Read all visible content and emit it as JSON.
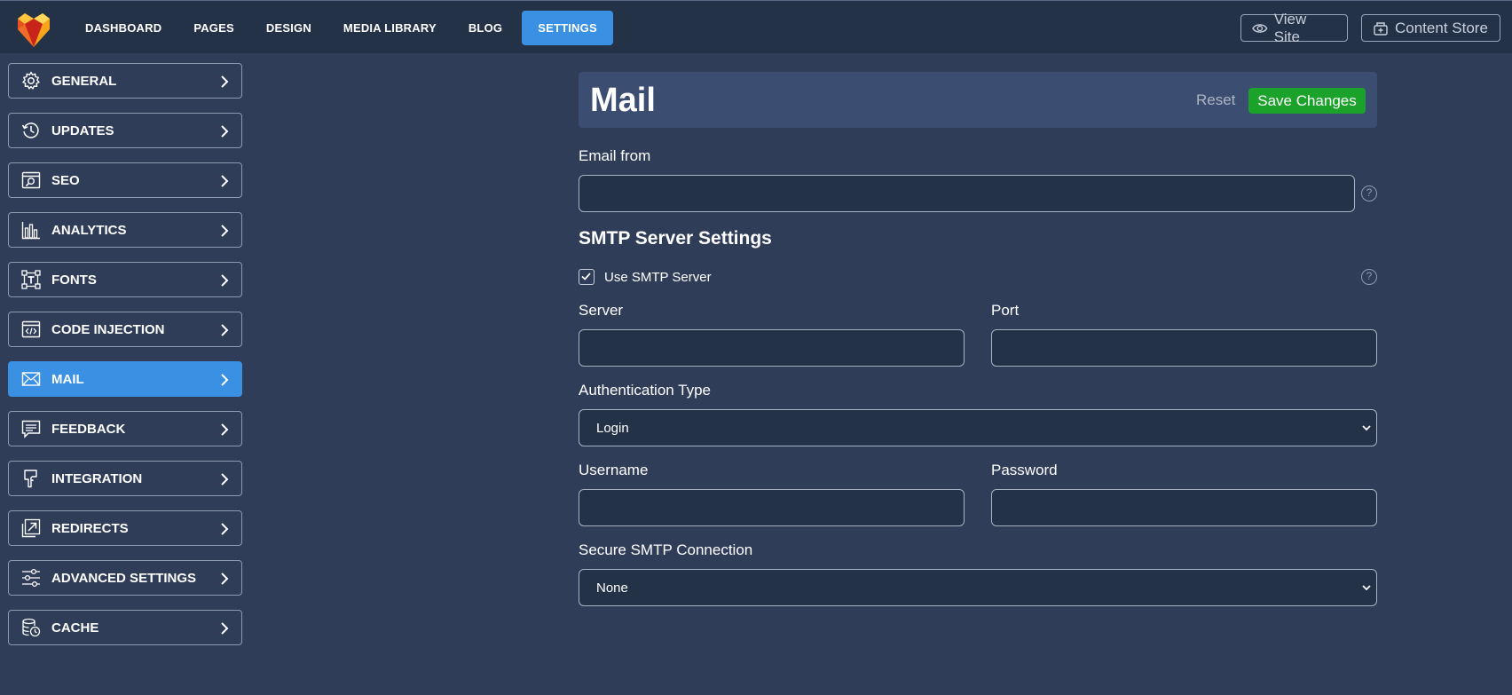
{
  "nav": {
    "items": [
      {
        "label": "DASHBOARD"
      },
      {
        "label": "PAGES"
      },
      {
        "label": "DESIGN"
      },
      {
        "label": "MEDIA LIBRARY"
      },
      {
        "label": "BLOG"
      },
      {
        "label": "SETTINGS",
        "active": true
      }
    ],
    "view_site": "View Site",
    "content_store": "Content Store"
  },
  "sidebar": {
    "items": [
      {
        "label": "GENERAL",
        "icon": "gear-icon"
      },
      {
        "label": "UPDATES",
        "icon": "history-icon"
      },
      {
        "label": "SEO",
        "icon": "seo-icon"
      },
      {
        "label": "ANALYTICS",
        "icon": "bar-chart-icon"
      },
      {
        "label": "FONTS",
        "icon": "text-frame-icon"
      },
      {
        "label": "CODE INJECTION",
        "icon": "code-window-icon"
      },
      {
        "label": "MAIL",
        "icon": "envelope-icon",
        "active": true
      },
      {
        "label": "FEEDBACK",
        "icon": "message-icon"
      },
      {
        "label": "INTEGRATION",
        "icon": "plug-icon"
      },
      {
        "label": "REDIRECTS",
        "icon": "redirect-arrow-icon"
      },
      {
        "label": "ADVANCED SETTINGS",
        "icon": "sliders-icon"
      },
      {
        "label": "CACHE",
        "icon": "database-clock-icon"
      }
    ]
  },
  "main": {
    "title": "Mail",
    "reset_label": "Reset",
    "save_label": "Save Changes",
    "email_from": {
      "label": "Email from",
      "value": ""
    },
    "smtp_title": "SMTP Server Settings",
    "use_smtp": {
      "label": "Use SMTP Server",
      "checked": true
    },
    "server": {
      "label": "Server",
      "value": ""
    },
    "port": {
      "label": "Port",
      "value": ""
    },
    "auth_type": {
      "label": "Authentication Type",
      "selected": "Login"
    },
    "username": {
      "label": "Username",
      "value": ""
    },
    "password": {
      "label": "Password",
      "value": ""
    },
    "secure": {
      "label": "Secure SMTP Connection",
      "selected": "None"
    },
    "help_glyph": "?"
  },
  "colors": {
    "topbar": "#243248",
    "background": "#2f3d58",
    "accent": "#3a91e3",
    "save": "#1aa22a",
    "header": "#3b4d70"
  }
}
